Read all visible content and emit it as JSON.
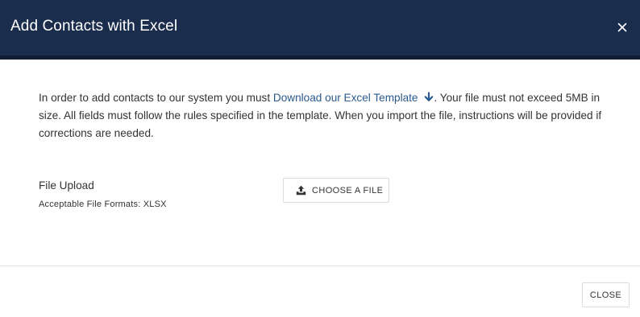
{
  "header": {
    "title": "Add Contacts with Excel",
    "close_icon": "close-icon",
    "background_color": "#1b2d4d"
  },
  "body": {
    "intro_before": "In order to add contacts to our system you must ",
    "download_link": "Download our Excel Template",
    "download_icon": "download-arrow-icon",
    "intro_after": ". Your file must not exceed 5MB in size. All fields must follow the rules specified in the template. When you import the file, instructions will be provided if corrections are needed.",
    "link_color": "#2a5a8c"
  },
  "upload": {
    "label": "File Upload",
    "formats": "Acceptable File Formats: XLSX",
    "button_label": "CHOOSE A FILE",
    "button_icon": "upload-icon"
  },
  "footer": {
    "close_label": "CLOSE"
  }
}
